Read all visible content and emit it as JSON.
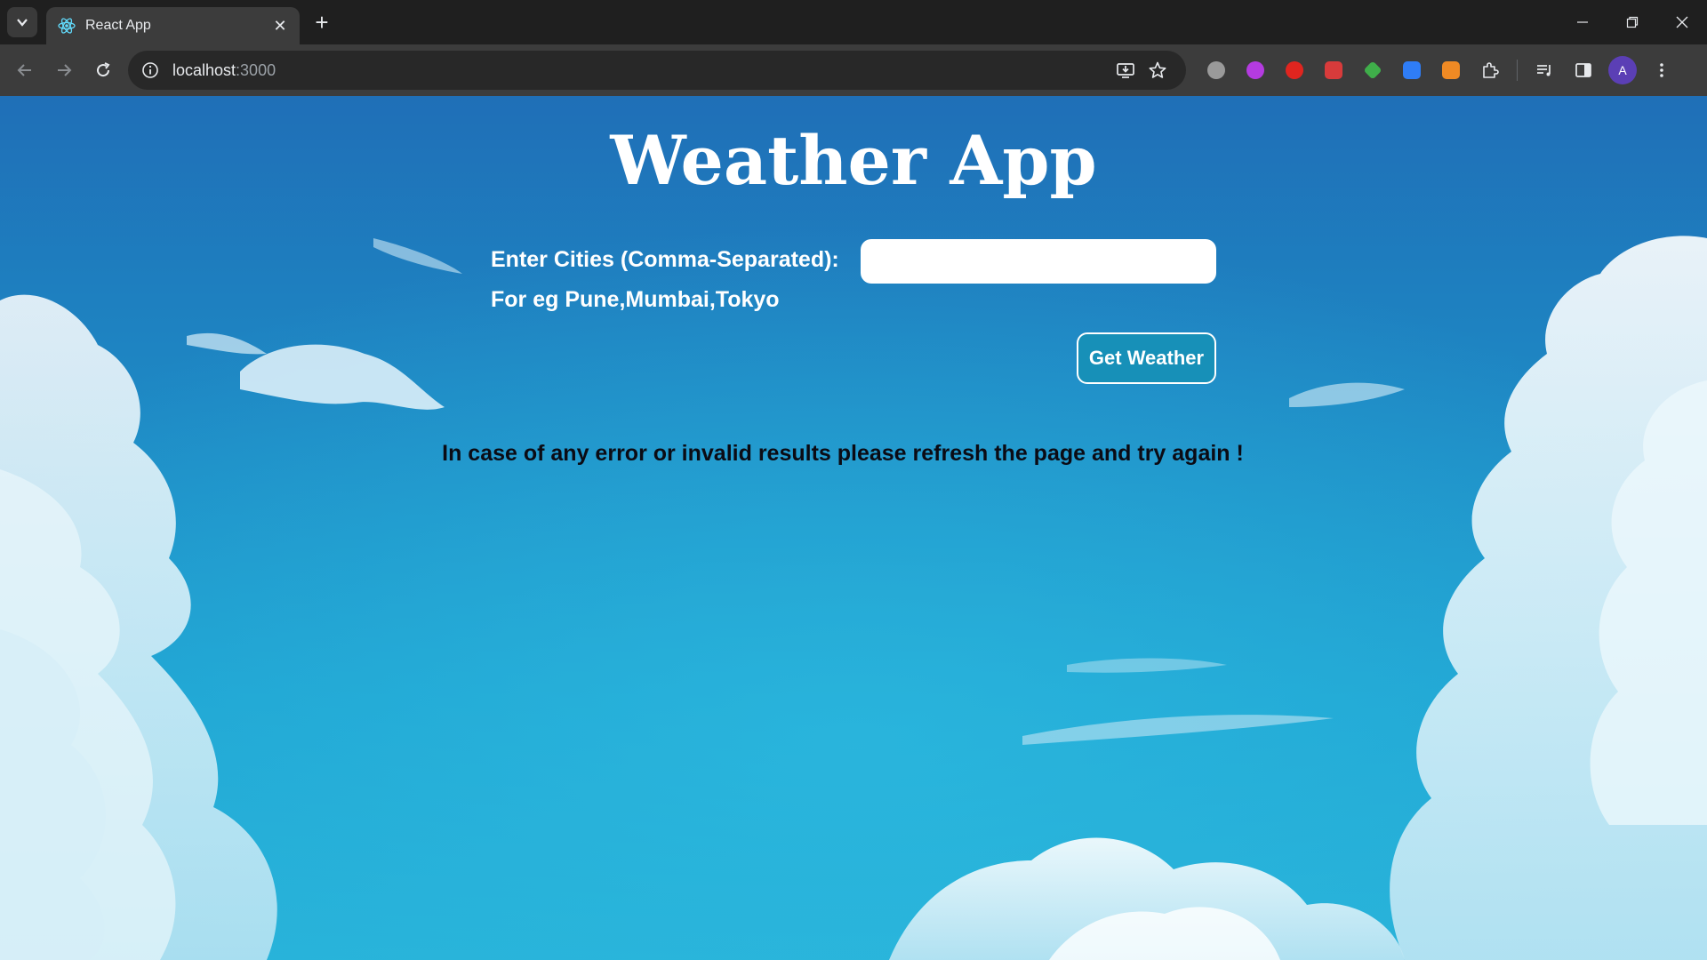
{
  "browser": {
    "tab_title": "React App",
    "url_host": "localhost",
    "url_port": ":3000",
    "avatar_letter": "A",
    "accent": "#5b3fb5"
  },
  "app": {
    "title": "Weather App",
    "cities_label": "Enter Cities (Comma-Separated):",
    "example_label": "For eg Pune,Mumbai,Tokyo",
    "input_value": "",
    "button_label": "Get Weather",
    "error_note": "In case of any error or invalid results please refresh the page and try again !"
  },
  "colors": {
    "sky_top": "#1f6fb7",
    "sky_bottom": "#27b1d8",
    "button_bg": "#1790b8"
  },
  "icons": {
    "tab_search": "chevron-down-icon",
    "favicon": "react-icon",
    "back": "arrow-left-icon",
    "forward": "arrow-right-icon",
    "reload": "reload-icon",
    "site_info": "info-icon",
    "install": "install-app-icon",
    "bookmark": "star-icon",
    "extensions": "puzzle-icon",
    "media": "media-controls-icon",
    "side_panel": "side-panel-icon",
    "menu": "kebab-menu-icon"
  }
}
